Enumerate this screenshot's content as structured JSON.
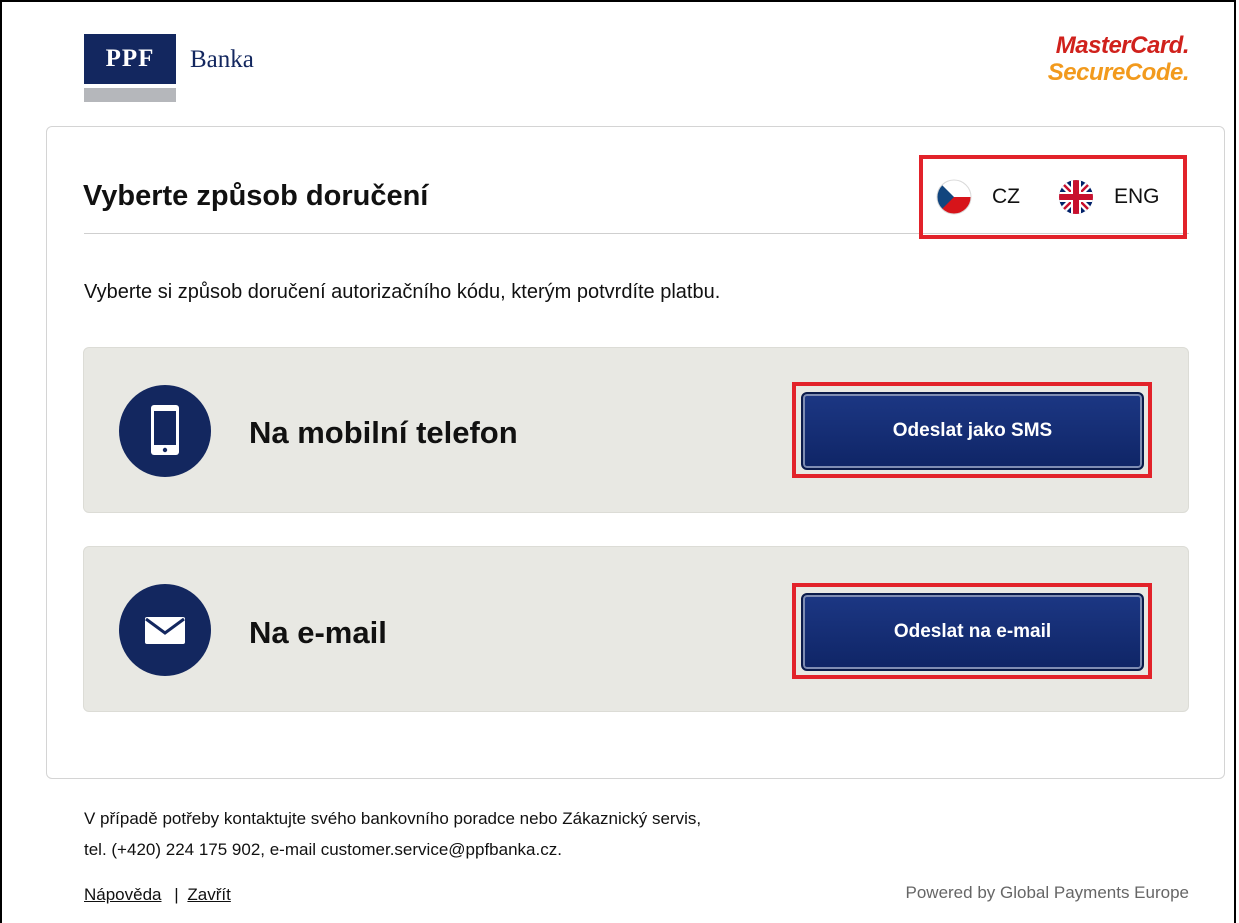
{
  "header": {
    "bank_logo_mark": "PPF",
    "bank_logo_name": "Banka",
    "card_brand_line1": "MasterCard.",
    "card_brand_line2": "SecureCode."
  },
  "main": {
    "title": "Vyberte způsob doručení",
    "intro": "Vyberte si způsob doručení autorizačního kódu, kterým potvrdíte platbu.",
    "languages": [
      {
        "code": "CZ",
        "icon": "czech-flag-icon"
      },
      {
        "code": "ENG",
        "icon": "uk-flag-icon"
      }
    ],
    "options": [
      {
        "label": "Na mobilní telefon",
        "icon": "mobile-phone-icon",
        "button": "Odeslat jako SMS"
      },
      {
        "label": "Na e-mail",
        "icon": "envelope-icon",
        "button": "Odeslat na e-mail"
      }
    ]
  },
  "footer": {
    "contact_line1": "V případě potřeby kontaktujte svého bankovního poradce nebo Zákaznický servis,",
    "contact_line2": "tel. (+420) 224 175 902, e-mail customer.service@ppfbanka.cz.",
    "help_link": "Nápověda",
    "separator": "|",
    "close_link": "Zavřít",
    "powered_by": "Powered by Global Payments Europe"
  },
  "colors": {
    "brand_navy": "#13275f",
    "highlight_red": "#e2222a",
    "option_background": "#e8e8e3"
  }
}
